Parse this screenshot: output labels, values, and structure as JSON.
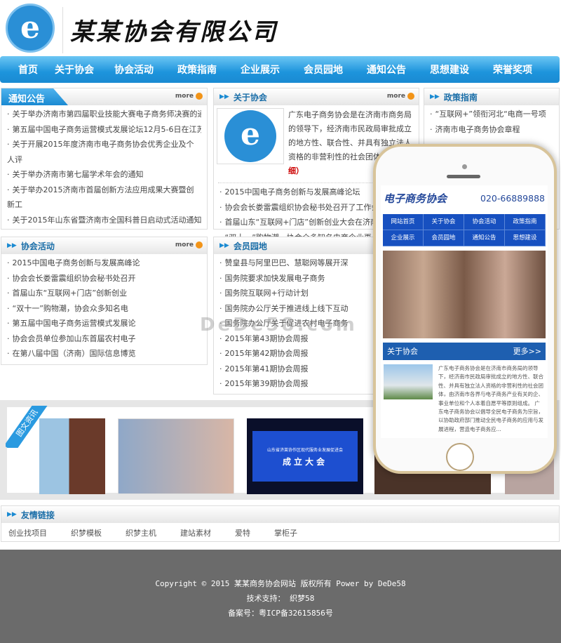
{
  "header": {
    "logo_letter": "e",
    "brand": "某某协会有限公司"
  },
  "nav": [
    "首页",
    "关于协会",
    "协会活动",
    "政策指南",
    "企业展示",
    "会员园地",
    "通知公告",
    "思想建设",
    "荣誉奖项"
  ],
  "more": "more",
  "notice": {
    "title": "通知公告",
    "items": [
      "关于举办济南市第四届职业技能大赛电子商务师决赛的通",
      "第五届中国电子商务运营模式发展论坛12月5-6日在江苏",
      "关于开展2015年度济南市电子商务协会优秀企业及个人评",
      "关于举办济南市第七届学术年会的通知",
      "关于举办2015济南市首届创新方法应用成果大赛暨创新工",
      "关于2015年山东省暨济南市全国科普日启动式活动通知"
    ]
  },
  "about": {
    "title": "关于协会",
    "logo_letter": "e",
    "intro": "广东电子商务协会是在济南市商务局的领导下，经济南市民政局审批成立的地方性、联合性、并具有独立法人资格的非营利性的社会团体...",
    "detail": "（详细）",
    "items": [
      "2015中国电子商务创新与发展高峰论坛",
      "协会会长娄雷震组织协会秘书处召开了工作会",
      "首届山东“互联网+门店”创新创业大会在济南",
      "“双十一”购物潮，协会众多知名电商企业再"
    ]
  },
  "policy": {
    "title": "政策指南",
    "items": [
      "“互联网+”领衔河北“电商一号项",
      "济南市电子商务协会章程"
    ]
  },
  "activity": {
    "title": "协会活动",
    "items": [
      "2015中国电子商务创新与发展高峰论",
      "协会会长娄雷震组织协会秘书处召开",
      "首届山东“互联网+门店”创新创业",
      "“双十一”购物潮，协会众多知名电",
      "第五届中国电子商务运营模式发展论",
      "协会会员单位参加山东首届农村电子",
      "在第八届中国（济南）国际信息博览"
    ]
  },
  "member": {
    "title": "会员园地",
    "items": [
      "赞皇县与阿里巴巴、慧聪网等展开深",
      "国务院要求加快发展电子商务",
      "国务院互联网+行动计划",
      "国务院办公厅关于推进线上线下互动",
      "国务院办公厅关于促进农村电子商务",
      "2015年第43期协会周报",
      "2015年第42期协会周报",
      "2015年第41期协会周报",
      "2015年第39期协会周报"
    ]
  },
  "gallery": {
    "tag": "图文资讯",
    "slide_title": "山东省济莱协作区现代服务业发展促进会",
    "slide_sub": "成立大会"
  },
  "friend_links": {
    "title": "友情链接",
    "items": [
      "创业找项目",
      "织梦模板",
      "织梦主机",
      "建站素材",
      "爱特",
      "掌柜子"
    ]
  },
  "footer": {
    "copyright": "Copyright © 2015 某某商务协会网站 版权所有 Power by DeDe58",
    "support": "技术支持： 织梦58",
    "icp": "备案号：粤ICP备32615856号"
  },
  "watermark": "DeDe58.com",
  "phone": {
    "name": "电子商务协会",
    "tel": "020-66889888",
    "nav": [
      "网站首页",
      "关于协会",
      "协会活动",
      "政策指南",
      "企业展示",
      "会员园地",
      "通知公告",
      "思想建设"
    ],
    "about_title": "关于协会",
    "about_more": "更多>>",
    "about_text": "广东电子商务协会是在济南市商务局的领导下，经济南市民政局审批成立的地方性、联合性、并具有独立法人资格的非营利性的社会团体，由济南市各界与电子商务产业有关的企、事业单位和个人本着自愿平等原则组成。 广东电子商务协会以倡导全民电子商务为宗旨，以协助政府部门推动全民电子商务的应用与发展进程，营造电子商务应..."
  }
}
